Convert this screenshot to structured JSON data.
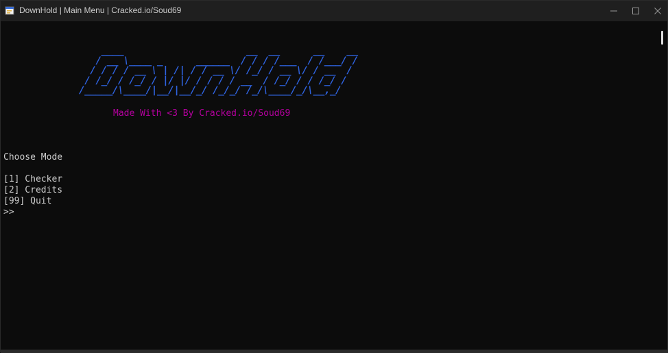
{
  "window": {
    "title": "DownHold | Main Menu | Cracked.io/Soud69"
  },
  "icons": {
    "app": "console-app-icon",
    "minimize": "minimize-icon",
    "maximize": "maximize-icon",
    "close": "close-icon"
  },
  "console": {
    "logo_lines": [
      "    ____                      __  __      __    __",
      "   / __ \\____ _      ______  / / / /___  / /___/ /",
      "  / / / / __ \\ | /| / / __ \\/ /_/ / __ \\/ / __  / ",
      " / /_/ / /_/ / |/ |/ / / / / __  / /_/ / / /_/ /  ",
      "/_____/\\____/|__/|__/_/ /_/_/ /_/\\____/_/\\__,_/   "
    ],
    "credit": "Made With <3 By Cracked.io/Soud69",
    "prompt_heading": "Choose Mode",
    "options": [
      "[1] Checker",
      "[2] Credits",
      "[99] Quit"
    ],
    "input_prompt": ">>"
  },
  "colors": {
    "titlebar_bg": "#1f1f1f",
    "console_bg": "#0c0c0c",
    "console_text": "#cccccc",
    "logo_blue": "#2f63e0",
    "credit_magenta": "#b4009e"
  }
}
